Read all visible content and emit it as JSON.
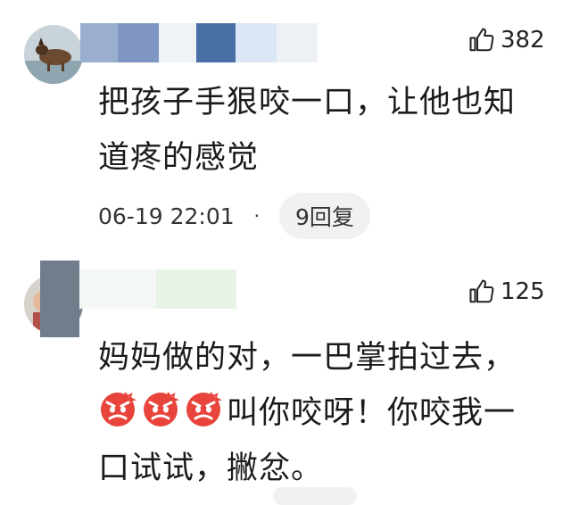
{
  "comments": [
    {
      "likes": "382",
      "text_line1": "把孩子手狠咬一口，让他也知",
      "text_line2": "道疼的感觉",
      "timestamp": "06-19 22:01",
      "separator": "·",
      "replies_label": "9回复"
    },
    {
      "likes": "125",
      "text_line1": "妈妈做的对，一巴掌拍过去，",
      "text_line2_suffix": "叫你咬呀！你咬我一",
      "text_line3": "口试试，撇忿。",
      "emoji_name": "angry-face-emoji"
    }
  ],
  "colors": {
    "pixel_blocks_1": [
      "#9aaecf",
      "#7f97c2",
      "#eef3f8",
      "#4a6fa6",
      "#dbe7f6",
      "#edf1f6"
    ],
    "pixel_blocks_2": [
      "#6f7e8a",
      "#f4f8f4",
      "#e7f4e6"
    ],
    "pill_bg": "#f1f1f1",
    "emoji_red": "#e8443c"
  }
}
